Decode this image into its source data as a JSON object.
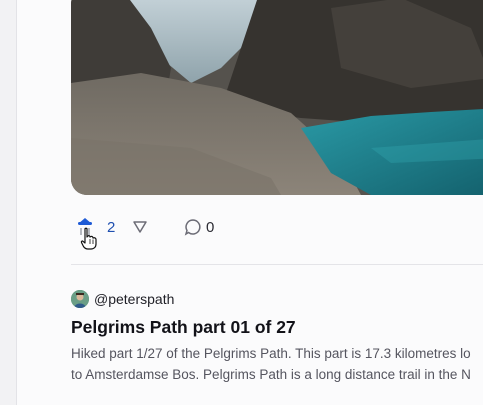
{
  "post": {
    "votes": "2",
    "comments": "0",
    "author": "@peterspath",
    "title": "Pelgrims Path part 01 of 27",
    "body_lines": [
      "Hiked part 1/27 of the Pelgrims Path. This part is 17.3 kilometres lo",
      "to Amsterdamse Bos. Pelgrims Path is a long distance trail in the N"
    ]
  },
  "icons": {
    "upvote": "upvote-arrow-icon",
    "downvote": "downvote-arrow-icon",
    "comment": "comment-bubble-icon",
    "cursor": "hand-pointer-cursor-icon"
  },
  "colors": {
    "upvote_active": "#1e5bd6",
    "vote_count": "#1e4fb0",
    "lake": "#1f8a98"
  }
}
